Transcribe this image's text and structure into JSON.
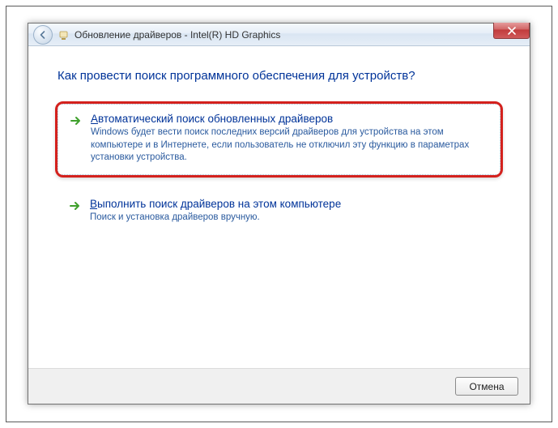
{
  "titlebar": {
    "title": "Обновление драйверов - Intel(R) HD Graphics"
  },
  "content": {
    "heading": "Как провести поиск программного обеспечения для устройств?",
    "options": [
      {
        "first_char": "А",
        "title_rest": "втоматический поиск обновленных драйверов",
        "desc": "Windows будет вести поиск последних версий драйверов для устройства на этом компьютере и в Интернете, если пользователь не отключил эту функцию в параметрах установки устройства."
      },
      {
        "first_char": "В",
        "title_rest": "ыполнить поиск драйверов на этом компьютере",
        "desc": "Поиск и установка драйверов вручную."
      }
    ]
  },
  "footer": {
    "cancel": "Отмена"
  }
}
